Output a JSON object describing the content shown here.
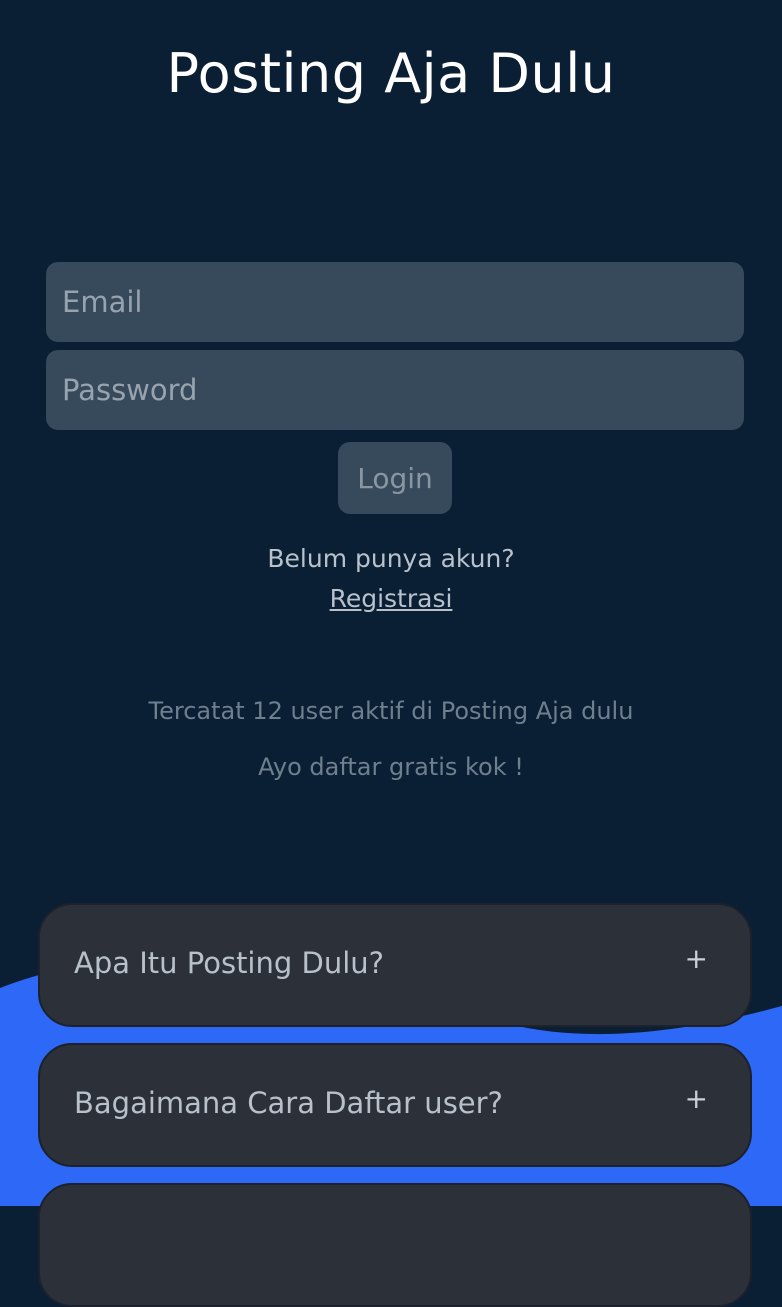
{
  "header": {
    "title": "Posting Aja Dulu"
  },
  "login_form": {
    "email_placeholder": "Email",
    "password_placeholder": "Password",
    "login_label": "Login"
  },
  "register": {
    "prompt": "Belum punya akun?",
    "link_label": "Registrasi"
  },
  "stats": {
    "active_users_text": "Tercatat 12 user aktif di Posting Aja dulu",
    "cta_text": "Ayo daftar gratis kok !"
  },
  "faq": {
    "items": [
      {
        "question": "Apa Itu Posting Dulu?",
        "toggle_icon": "+"
      },
      {
        "question": "Bagaimana Cara Daftar user?",
        "toggle_icon": "+"
      }
    ]
  },
  "colors": {
    "background": "#0a1f33",
    "input_bg": "#374a5c",
    "accent_wave": "#2d68f7",
    "faq_bg": "#2c3039"
  }
}
